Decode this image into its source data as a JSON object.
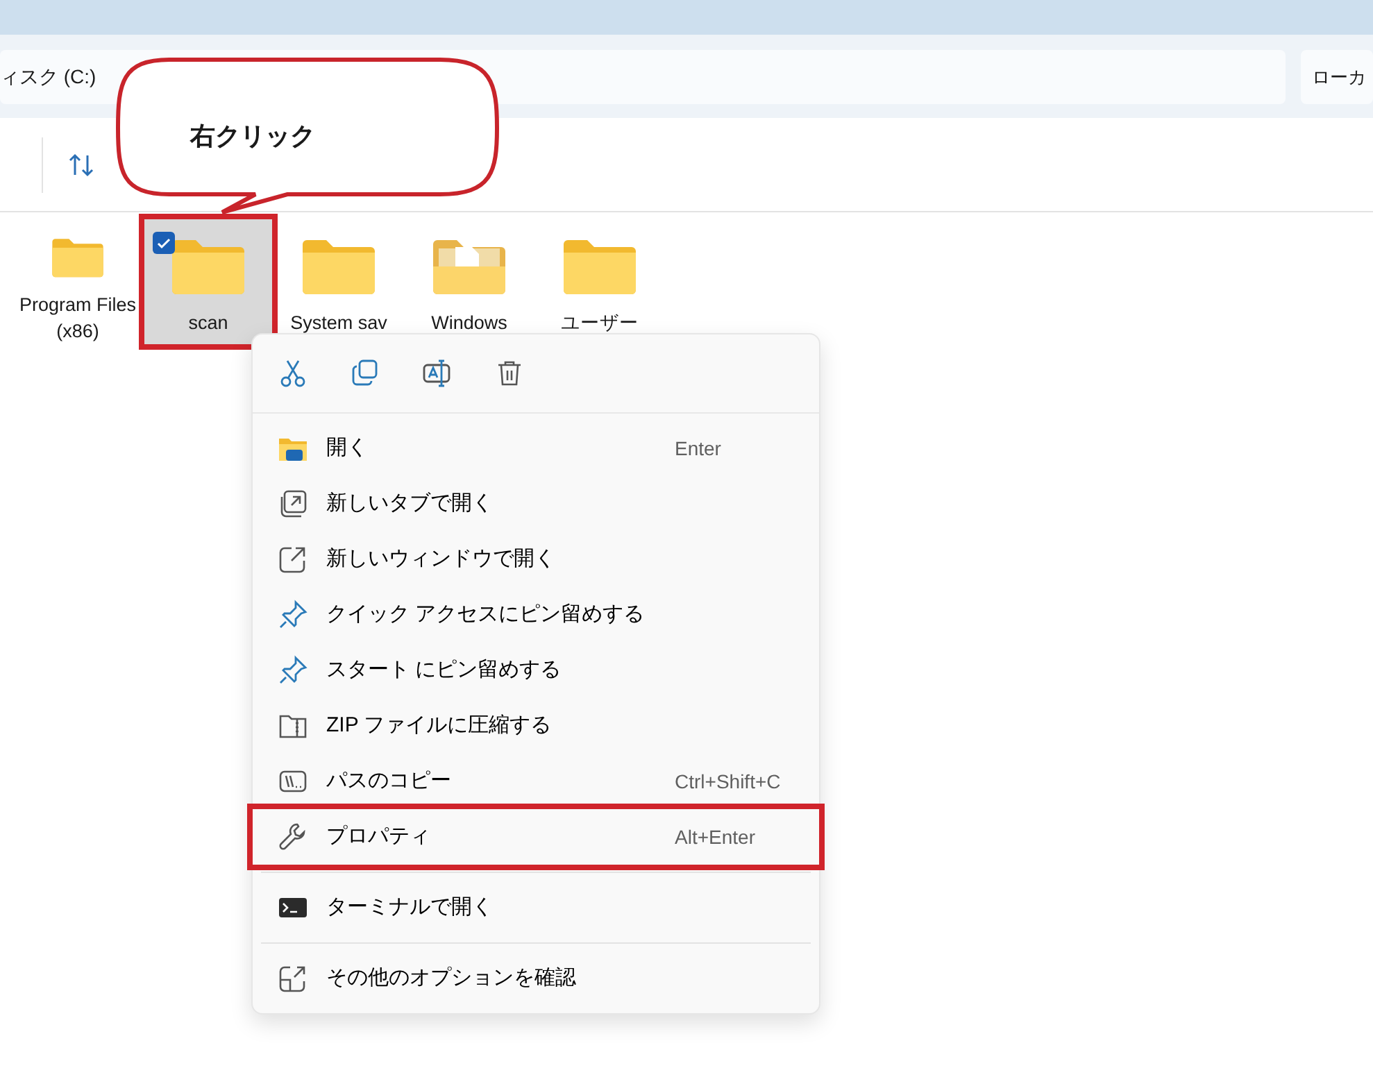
{
  "address_bar": {
    "path": "ィスク (C:)"
  },
  "search": {
    "placeholder": "ローカ"
  },
  "folders": [
    {
      "name": "Program Files (x86)",
      "kind": "folder",
      "selected": false,
      "highlighted": false
    },
    {
      "name": "scan",
      "kind": "folder",
      "selected": true,
      "highlighted": true
    },
    {
      "name": "System sav",
      "kind": "folder",
      "selected": false,
      "highlighted": false
    },
    {
      "name": "Windows",
      "kind": "document-folder",
      "selected": false,
      "highlighted": false
    },
    {
      "name": "ユーザー",
      "kind": "folder",
      "selected": false,
      "highlighted": false
    }
  ],
  "context_menu": {
    "quick_actions": [
      {
        "kind": "cut"
      },
      {
        "kind": "copy"
      },
      {
        "kind": "rename"
      },
      {
        "kind": "delete"
      }
    ],
    "sections": [
      [
        {
          "kind": "open",
          "label": "開く",
          "shortcut": "Enter",
          "highlighted": false
        },
        {
          "kind": "new-tab",
          "label": "新しいタブで開く",
          "highlighted": false
        },
        {
          "kind": "new-window",
          "label": "新しいウィンドウで開く",
          "highlighted": false
        },
        {
          "kind": "pin",
          "label": "クイック アクセスにピン留めする",
          "highlighted": false
        },
        {
          "kind": "pin",
          "label": "スタート にピン留めする",
          "highlighted": false
        },
        {
          "kind": "zip",
          "label": "ZIP ファイルに圧縮する",
          "highlighted": false
        },
        {
          "kind": "copy-path",
          "label": "パスのコピー",
          "shortcut": "Ctrl+Shift+C",
          "highlighted": false
        },
        {
          "kind": "properties",
          "label": "プロパティ",
          "shortcut": "Alt+Enter",
          "highlighted": true
        }
      ],
      [
        {
          "kind": "terminal",
          "label": "ターミナルで開く",
          "highlighted": false
        }
      ],
      [
        {
          "kind": "more",
          "label": "その他のオプションを確認",
          "highlighted": false
        }
      ]
    ]
  },
  "callout": {
    "text": "右クリック"
  }
}
